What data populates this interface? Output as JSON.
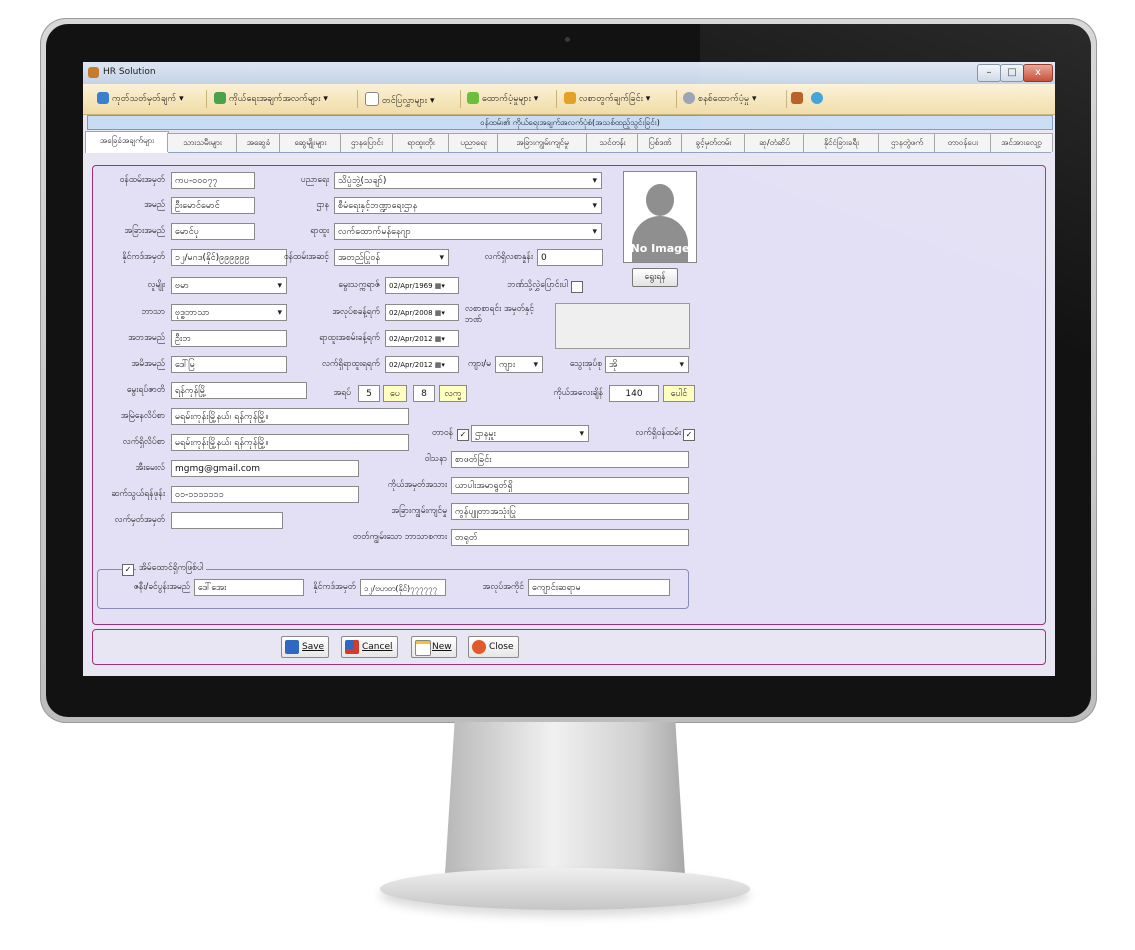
{
  "window": {
    "title": "HR Solution",
    "min_label": "–",
    "max_label": "□",
    "close_label": "x"
  },
  "menu": [
    {
      "label": "ကုတ်သတ်မှတ်ချက် ▾"
    },
    {
      "label": "ကိုယ်ရေးအချက်အလက်များ ▾"
    },
    {
      "label": "တင်ပြလွှာများ ▾"
    },
    {
      "label": "ထောက်ပံ့မှုများ ▾"
    },
    {
      "label": "လစာတွက်ချက်ခြင်း ▾"
    },
    {
      "label": "စနစ်ထောက်ပံ့မှု ▾"
    }
  ],
  "form_title": "ဝန်ထမ်း၏ ကိုယ်ရေးအချက်အလက်ပုံစံ(အသစ်ထည့်သွင်းခြင်း)",
  "tabs": [
    "အခြေခံအချက်များ",
    "သားသမီးများ",
    "အဆွေခံ",
    "ဆွေမျိုးများ",
    "ဌာနပြောင်း",
    "ရာထူးတိုး",
    "ပညာရေး",
    "အခြားကျွမ်းကျင်မှု",
    "သင်တန်း",
    "ပြစ်ဒဏ်",
    "ခွင့်မှတ်တမ်း",
    "ဆု/တံဆိပ်",
    "နိုင်ငံခြားခရီး",
    "ဌာနတွဲဖက်",
    "တာဝန်ပေး",
    "အင်အားလျော့"
  ],
  "fields": {
    "employee_id": {
      "label": "ဝန်ထမ်းအမှတ်",
      "value": "ကပ-၀၀၀၇၇"
    },
    "name": {
      "label": "အမည်",
      "value": "ဦးမောင်မောင်"
    },
    "nickname": {
      "label": "အခြားအမည်",
      "value": "မောင်ပု"
    },
    "nrc": {
      "label": "နိုင်ကဒ်အမှတ်",
      "value": "၁၂/မဂဒ(နိုင်)၉၉၉၉၉၉"
    },
    "race": {
      "label": "လူမျိုး",
      "value": "ဗမာ"
    },
    "religion": {
      "label": "ဘာသာ",
      "value": "ဗုဒ္ဓဘာသာ"
    },
    "father": {
      "label": "အဘအမည်",
      "value": "ဦးဘ"
    },
    "mother": {
      "label": "အမိအမည်",
      "value": "ဒေါ်မြ"
    },
    "birthplace": {
      "label": "မွေးရပ်ဇာတိ",
      "value": "ရန်ကုန်မြို့"
    },
    "permanent_addr": {
      "label": "အမြဲနေလိပ်စာ",
      "value": "မရမ်းကုန်းမြို့နယ်၊ ရန်ကုန်မြို့။"
    },
    "current_addr": {
      "label": "လက်ရှိလိပ်စာ",
      "value": "မရမ်းကုန်းမြို့နယ်၊ ရန်ကုန်မြို့။"
    },
    "email": {
      "label": "အီးမေးလ်",
      "value": "mgmg@gmail.com"
    },
    "phone": {
      "label": "ဆက်သွယ်ရန်ဖုန်း",
      "value": "၀၁-၁၁၁၁၁၁၁"
    },
    "tax_id": {
      "label": "လက်မှတ်အမှတ်",
      "value": ""
    },
    "education": {
      "label": "ပညာရေး",
      "value": "သိပ္ပံဘွဲ့(သချာ်)"
    },
    "department": {
      "label": "ဌာန",
      "value": "စီမံရေးနှင့်ဘဏ္ဍာရေးဌာန"
    },
    "position": {
      "label": "ရာထူး",
      "value": "လက်ထောက်မန်နေဂျာ"
    },
    "grade": {
      "label": "ဝန်ထမ်းအဆင့်",
      "value": "အတည်ပြုဝန်"
    },
    "salary": {
      "label": "လက်ရှိလစာနှုန်း",
      "value": "0"
    },
    "dob": {
      "label": "မွေးသက္ကရာဇ်",
      "value": "02/Apr/1969"
    },
    "join_date": {
      "label": "အလုပ်စခန့်ရက်",
      "value": "02/Apr/2008"
    },
    "position_date": {
      "label": "ရာထူးအစမ်းခန့်ရက်",
      "value": "02/Apr/2012"
    },
    "current_pos_date": {
      "label": "လက်ရှိရာထူးရရက်",
      "value": "02/Apr/2012"
    },
    "age": {
      "label": "အရပ်",
      "value_ft": "5",
      "unit_ft": "ပေ",
      "value_in": "8",
      "unit_in": "လက္မ"
    },
    "weight": {
      "label": "ကိုယ်အလေးချိန်",
      "value": "140",
      "unit": "ပေါင်"
    },
    "disabled": {
      "label": "ဘဏ်သို့လွှဲပြောင်းပါ",
      "checked": false
    },
    "bank_memo_label": "လစာစာရင်း အမှတ်နှင့်ဘဏ်",
    "gender": {
      "label": "ကျား/မ",
      "value": "ကျား"
    },
    "blood": {
      "label": "သွေးအုပ်စု",
      "value": "အို"
    },
    "duty": {
      "label": "တာဝန်",
      "checked": true,
      "value": "ဌာနမှူး"
    },
    "current_staff": {
      "label": "လက်ရှိဝန်ထမ်း",
      "checked": true
    },
    "hobby": {
      "label": "ဝါသနာ",
      "value": "စာဖတ်ခြင်း"
    },
    "identification": {
      "label": "ကိုယ်အမှတ်အသား",
      "value": "ယာပါးအမာရွတ်ရှိ"
    },
    "other_skill": {
      "label": "အခြားကျွမ်းကျင်မှု",
      "value": "ကွန်ပျူတာအသုံးပြု"
    },
    "language": {
      "label": "တတ်ကျွမ်းသော ဘာသာစကား",
      "value": "တရုတ်"
    }
  },
  "photo": {
    "no_image": "No Image",
    "browse_label": "ရွေးရန်"
  },
  "spouse": {
    "group_label": "အိမ်ထောင်ရှိကဖြစ်ပါ",
    "checked": true,
    "name_label": "ဇနီး/ခင်ပွန်းအမည်",
    "name_value": "ဒေါ်အေး",
    "nrc_label": "နိုင်ကဒ်အမှတ်",
    "nrc_value": "၁၂/ဗဟတ(နိုင်)၇၇၇၇၇၇",
    "job_label": "အလုပ်အကိုင်",
    "job_value": "ကျောင်းဆရာမ"
  },
  "buttons": {
    "save": "Save",
    "cancel": "Cancel",
    "new": "New",
    "close": "Close"
  },
  "colors": {
    "accent_border": "#a0307a",
    "panel_bg": "#e3e0f5",
    "menu_bg": "#f0dca6"
  }
}
